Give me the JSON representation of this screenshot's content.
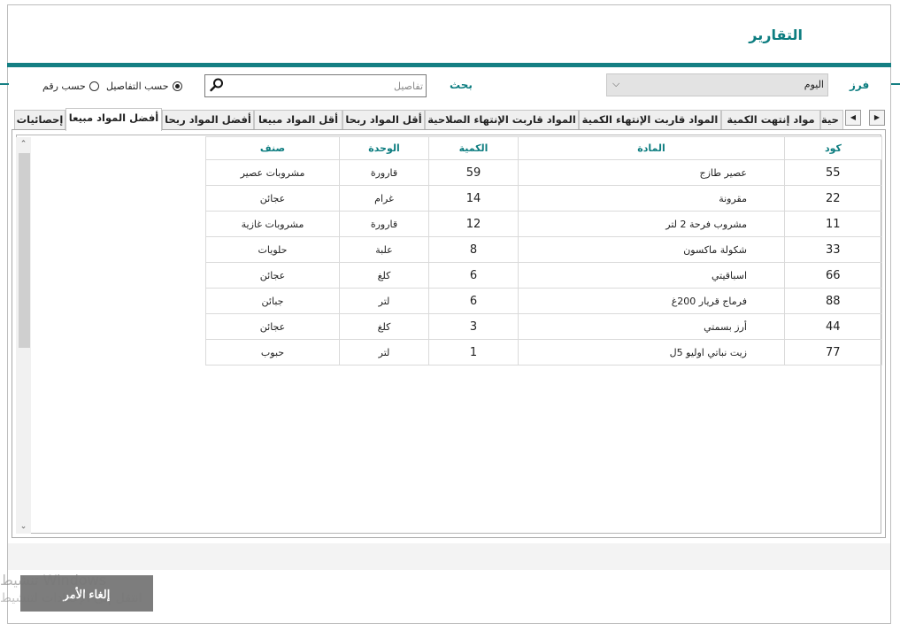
{
  "header": {
    "title": "التقارير"
  },
  "filters": {
    "sort_label": "فرز",
    "period_value": "اليوم",
    "search_label": "بحث",
    "search_placeholder": "تفاصيل",
    "radio_details": "حسب التفاصيل",
    "radio_number": "حسب رقم",
    "selected_radio": "details"
  },
  "tabs": [
    {
      "label": "إحصائيات"
    },
    {
      "label": "أفضل المواد مبيعا",
      "active": true
    },
    {
      "label": "أفضل المواد ربحا"
    },
    {
      "label": "أقل المواد مبيعا"
    },
    {
      "label": "أقل المواد ربحا"
    },
    {
      "label": "المواد قاربت الإنتهاء الصلاحية"
    },
    {
      "label": "المواد قاربت الإنتهاء الكمية"
    },
    {
      "label": "مواد إنتهت الكمية"
    },
    {
      "label": "حية"
    }
  ],
  "table": {
    "headers": {
      "category": "صنف",
      "unit": "الوحدة",
      "qty": "الكمية",
      "item": "المادة",
      "code": "كود"
    },
    "rows": [
      {
        "category": "مشروبات عصير",
        "unit": "قارورة",
        "qty": "59",
        "item": "عصير طازج",
        "code": "55"
      },
      {
        "category": "عجائن",
        "unit": "غرام",
        "qty": "14",
        "item": "مقرونة",
        "code": "22"
      },
      {
        "category": "مشروبات غازية",
        "unit": "قارورة",
        "qty": "12",
        "item": "مشروب فرحة 2 لتر",
        "code": "11"
      },
      {
        "category": "حلويات",
        "unit": "علبة",
        "qty": "8",
        "item": "شكولة ماكسون",
        "code": "33"
      },
      {
        "category": "عجائن",
        "unit": "كلغ",
        "qty": "6",
        "item": "اسباقيتي",
        "code": "66"
      },
      {
        "category": "جبائن",
        "unit": "لتر",
        "qty": "6",
        "item": "فرماج قريار 200غ",
        "code": "88"
      },
      {
        "category": "عجائن",
        "unit": "كلغ",
        "qty": "3",
        "item": "أرز بسمتي",
        "code": "44"
      },
      {
        "category": "حبوب",
        "unit": "لتر",
        "qty": "1",
        "item": "زيت نباتي اوليو 5ل",
        "code": "77"
      }
    ]
  },
  "footer": {
    "cancel_label": "إلغاء الأمر"
  },
  "watermark": {
    "line1": "تنشيط Windows",
    "line2": "انتقل إلى الإعدادات لتنشيط"
  },
  "colors": {
    "accent": "#147f83",
    "label": "#0d7d80"
  }
}
